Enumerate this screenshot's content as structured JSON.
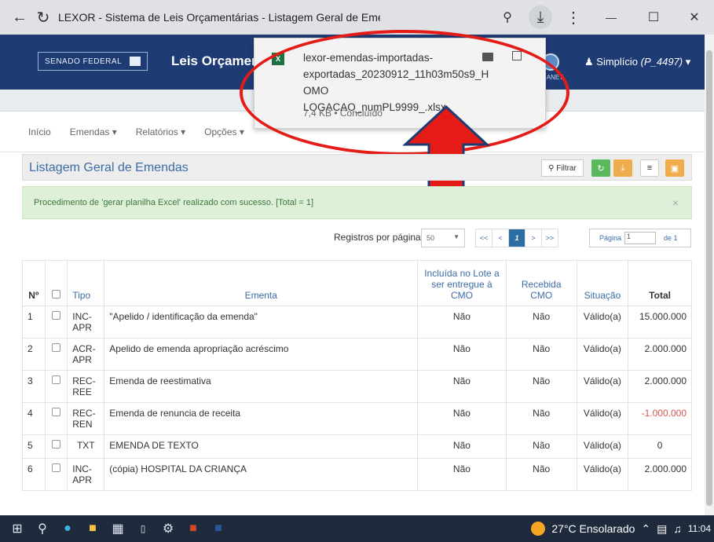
{
  "browser": {
    "back_icon": "arrow-left-icon",
    "reload_icon": "reload-icon",
    "title": "LEXOR - Sistema de Leis Orçamentárias - Listagem Geral de Emendas",
    "zoom_icon": "zoom-icon",
    "download_icon": "download-icon",
    "menu_icon": "kebab-icon"
  },
  "window": {
    "minimize": "—",
    "maximize": "☐",
    "close": "✕"
  },
  "header": {
    "senado": "SENADO FEDERAL",
    "brand": "Leis Orçamen",
    "intranet": "RANET",
    "user_icon": "user-icon",
    "user": "Simplício",
    "user_id": "(P_4497)"
  },
  "menu": {
    "inicio": "Início",
    "emendas": "Emendas ▾",
    "relatorios": "Relatórios ▾",
    "opcoes": "Opções ▾"
  },
  "download": {
    "filename": "lexor-emendas-importadas-exportadas_20230912_11h03m50s9_HOMOLOGACAO_numPL9999_xlsx",
    "filename_display": "lexor-emendas-importadas-\nexportadas_20230912_11h03m50s9_HOMO\nLOGACAO_numPL9999_.xlsx",
    "meta": "7,4 KB • Concluído"
  },
  "panel": {
    "title": "Listagem Geral de Emendas",
    "filter_label": "Filtrar"
  },
  "alert": {
    "message": "Procedimento de 'gerar planilha Excel' realizado com sucesso. [Total = 1]",
    "close": "×"
  },
  "pagination": {
    "per_page_label": "Registros por página:",
    "per_page_value": "50",
    "first": "<<",
    "prev": "<",
    "current": "1",
    "next": ">",
    "last": ">>",
    "page_label": "Página",
    "page_value": "1",
    "of_label": "de 1"
  },
  "table": {
    "headers": {
      "num": "Nº",
      "tipo": "Tipo",
      "ementa": "Ementa",
      "incluida": "Incluída no Lote a ser entregue à CMO",
      "recebida": "Recebida CMO",
      "situacao": "Situação",
      "total": "Total"
    },
    "rows": [
      {
        "n": "1",
        "tipo": "INC-APR",
        "ementa": "\"Apelido / identificação da emenda\"",
        "incluida": "Não",
        "recebida": "Não",
        "situacao": "Válido(a)",
        "total": "15.000.000"
      },
      {
        "n": "2",
        "tipo": "ACR-APR",
        "ementa": "Apelido de emenda apropriação acréscimo",
        "incluida": "Não",
        "recebida": "Não",
        "situacao": "Válido(a)",
        "total": "2.000.000"
      },
      {
        "n": "3",
        "tipo": "REC-REE",
        "ementa": "Emenda de reestimativa",
        "incluida": "Não",
        "recebida": "Não",
        "situacao": "Válido(a)",
        "total": "2.000.000"
      },
      {
        "n": "4",
        "tipo": "REC-REN",
        "ementa": "Emenda de renuncia de receita",
        "incluida": "Não",
        "recebida": "Não",
        "situacao": "Válido(a)",
        "total": "-1.000.000"
      },
      {
        "n": "5",
        "tipo": "TXT",
        "ementa": "EMENDA DE TEXTO",
        "incluida": "Não",
        "recebida": "Não",
        "situacao": "Válido(a)",
        "total": "0"
      },
      {
        "n": "6",
        "tipo": "INC-APR",
        "ementa": "(cópia) HOSPITAL DA CRIANÇA",
        "incluida": "Não",
        "recebida": "Não",
        "situacao": "Válido(a)",
        "total": "2.000.000"
      }
    ]
  },
  "taskbar": {
    "weather": "27°C Ensolarado",
    "time": "11:04",
    "icons": [
      "windows-start-icon",
      "search-icon",
      "edge-icon",
      "file-explorer-icon",
      "calculator-icon",
      "app-icon",
      "settings-icon",
      "powerpoint-icon",
      "word-icon"
    ]
  },
  "colors": {
    "header_bg": "#1f3b73",
    "link": "#3c6ca8",
    "alert_bg": "#dff0d8",
    "negative": "#d9534f",
    "annotation": "#e41b17"
  }
}
